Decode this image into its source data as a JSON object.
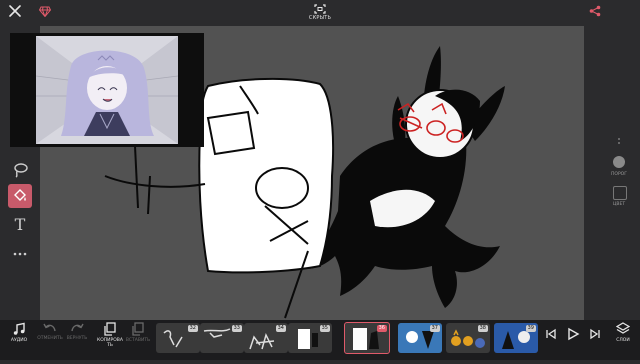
{
  "topbar": {
    "hide_label": "СКРЫТЬ",
    "close_icon": "close-icon",
    "gem_icon": "gem-icon",
    "share_icon": "share-icon"
  },
  "left_tools": {
    "items": [
      "lasso-icon",
      "fill-bucket-icon",
      "text-icon",
      "more-dots-icon"
    ],
    "text_glyph": "T"
  },
  "right_panel": {
    "threshold_label": "ПОРОГ",
    "color_label": "ЦВЕТ"
  },
  "bottom": {
    "audio_label": "АУДИО",
    "undo_label": "ОТМЕНИТЬ",
    "redo_label": "ВЕРНУТЬ",
    "copy_label": "КОПИРОВА ТЬ",
    "paste_label": "ВСТАВИТЬ",
    "layers_label": "СЛОИ",
    "frames": [
      {
        "number": "32"
      },
      {
        "number": "33"
      },
      {
        "number": "34"
      },
      {
        "number": "35"
      },
      {
        "number": "36"
      },
      {
        "number": "37"
      },
      {
        "number": "38"
      },
      {
        "number": "39"
      }
    ],
    "active_frame": "36"
  },
  "colors": {
    "accent": "#e05a6a",
    "fill_tool_bg": "#c85a6a",
    "canvas": "#525252",
    "bottom_bar": "#1c1c1e"
  }
}
